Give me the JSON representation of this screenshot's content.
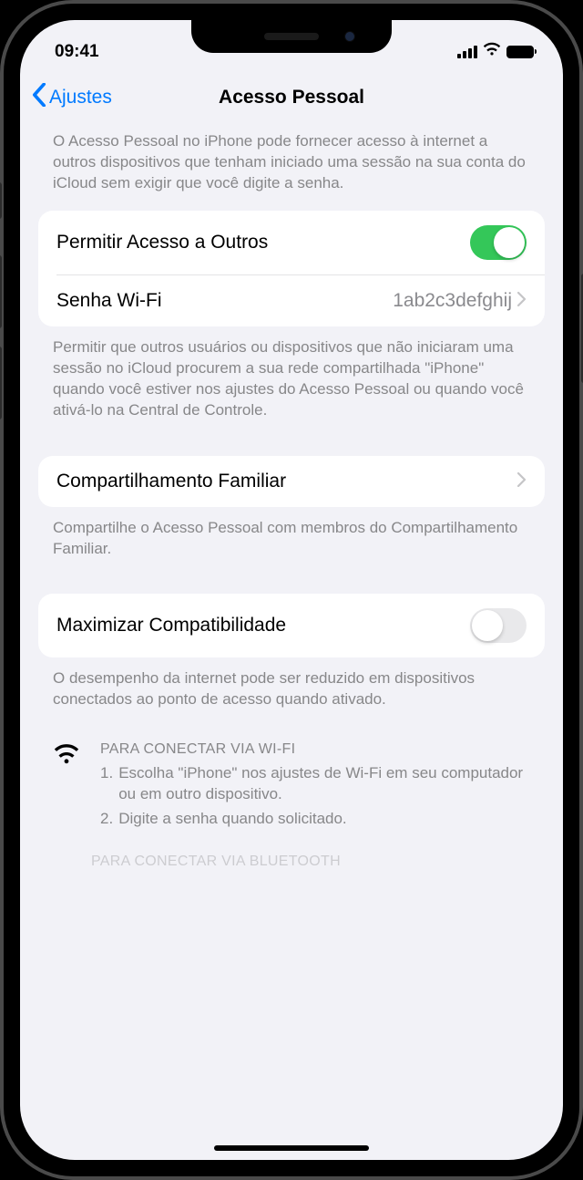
{
  "status": {
    "time": "09:41"
  },
  "nav": {
    "back": "Ajustes",
    "title": "Acesso Pessoal"
  },
  "intro": "O Acesso Pessoal no iPhone pode fornecer acesso à internet a outros dispositivos que tenham iniciado uma sessão na sua conta do iCloud sem exigir que você digite a senha.",
  "group1": {
    "allow_label": "Permitir Acesso a Outros",
    "wifi_label": "Senha Wi-Fi",
    "wifi_value": "1ab2c3defghij"
  },
  "group1_footer": "Permitir que outros usuários ou dispositivos que não iniciaram uma sessão no iCloud procurem a sua rede compartilhada \"iPhone\" quando você estiver nos ajustes do Acesso Pessoal ou quando você ativá-lo na Central de Controle.",
  "group2": {
    "family_label": "Compartilhamento Familiar"
  },
  "group2_footer": "Compartilhe o Acesso Pessoal com membros do Compartilhamento Familiar.",
  "group3": {
    "maximize_label": "Maximizar Compatibilidade"
  },
  "group3_footer": "O desempenho da internet pode ser reduzido em dispositivos conectados ao ponto de acesso quando ativado.",
  "instructions": {
    "wifi_header": "PARA CONECTAR VIA WI-FI",
    "wifi_steps": [
      "Escolha \"iPhone\" nos ajustes de Wi-Fi em seu computador ou em outro dispositivo.",
      "Digite a senha quando solicitado."
    ],
    "bt_header": "PARA CONECTAR VIA BLUETOOTH"
  }
}
